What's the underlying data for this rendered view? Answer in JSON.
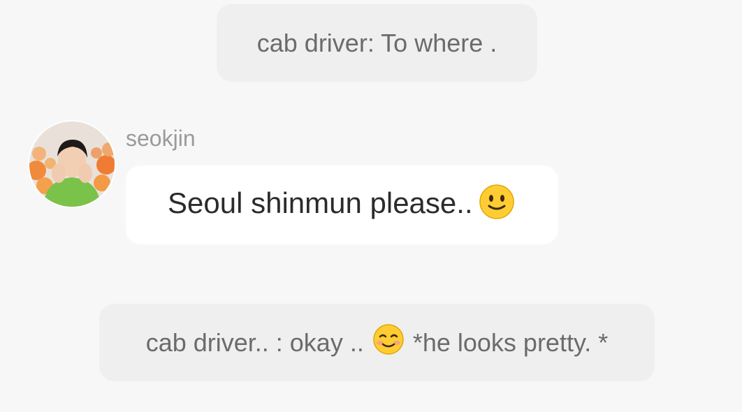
{
  "messages": [
    {
      "type": "narration",
      "text": "cab driver: To where ."
    },
    {
      "type": "chat",
      "sender": "seokjin",
      "text": "Seoul shinmun please..",
      "emoji": "slightly-smiling-face"
    },
    {
      "type": "narration",
      "text_before": "cab driver.. : okay ..",
      "emoji": "smiling-face",
      "text_after": "*he looks pretty. *"
    }
  ],
  "colors": {
    "background": "#f7f7f7",
    "narration_bubble": "#efefef",
    "chat_bubble": "#ffffff",
    "emoji_yellow": "#ffcc33"
  }
}
